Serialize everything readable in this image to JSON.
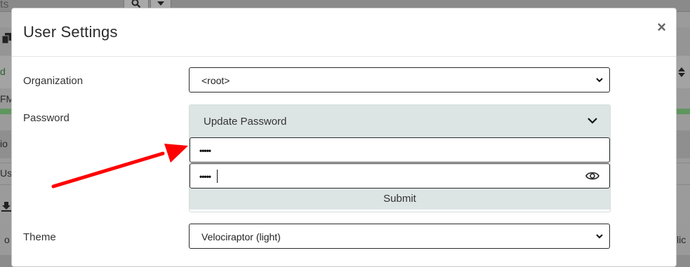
{
  "background": {
    "search_partial": "ts",
    "row_fragments": [
      "d",
      "FM",
      "io",
      "Use",
      "o"
    ],
    "right_fragment": "lic"
  },
  "modal": {
    "title": "User Settings",
    "close_icon": "close-icon",
    "organization": {
      "label": "Organization",
      "selected": "<root>"
    },
    "password": {
      "label": "Password",
      "toggle_label": "Update Password",
      "field1_masked": "•••••",
      "field2_masked": "•••••",
      "submit_label": "Submit"
    },
    "theme": {
      "label": "Theme",
      "selected": "Velociraptor (light)"
    }
  },
  "annotation": {
    "arrow_color": "#ff0000"
  },
  "icons": [
    "search-icon",
    "caret-down-icon",
    "copy-icon",
    "sort-icon",
    "download-icon",
    "chevron-down-icon",
    "eye-icon"
  ]
}
